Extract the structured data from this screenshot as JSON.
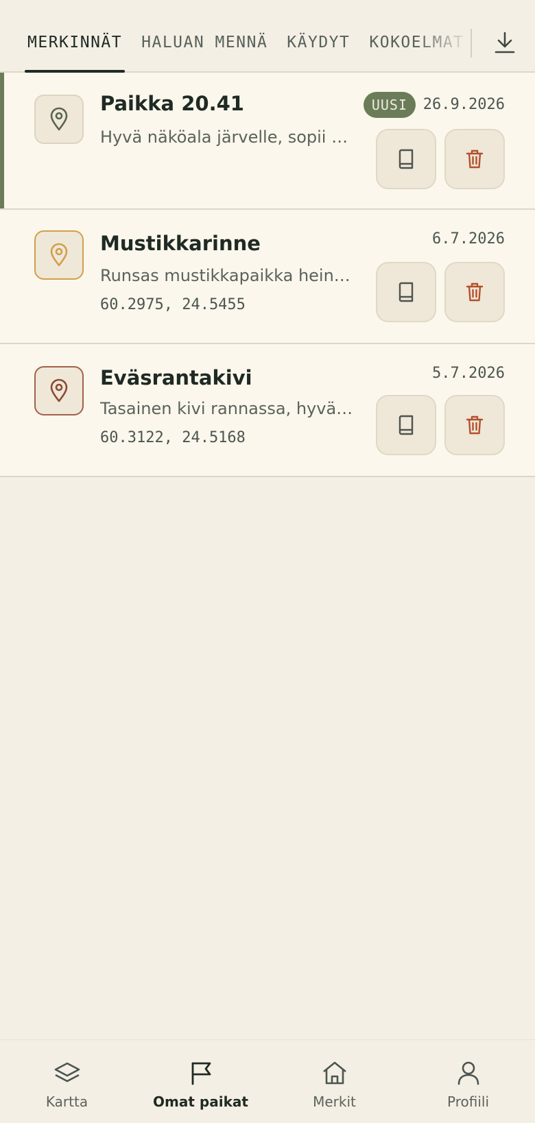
{
  "tabs": [
    {
      "label": "MERKINNÄT",
      "active": true
    },
    {
      "label": "HALUAN MENNÄ",
      "active": false
    },
    {
      "label": "KÄYDYT",
      "active": false
    },
    {
      "label": "KOKOELMAT",
      "active": false
    }
  ],
  "items": [
    {
      "title": "Paikka 20.41",
      "desc": "Hyvä näköala järvelle, sopii e...",
      "coords": "",
      "date": "26.9.2026",
      "badge": "UUSI",
      "pin_color": "#5a6451"
    },
    {
      "title": "Mustikkarinne",
      "desc": "Runsas mustikkapaikka heinä...",
      "coords": "60.2975, 24.5455",
      "date": "6.7.2026",
      "badge": "",
      "pin_color": "#d0a04a"
    },
    {
      "title": "Eväsrantakivi",
      "desc": "Tasainen kivi rannassa, hyvä p...",
      "coords": "60.3122, 24.5168",
      "date": "5.7.2026",
      "badge": "",
      "pin_color": "#8a4a34"
    }
  ],
  "nav": [
    {
      "label": "Kartta",
      "icon": "layers-icon"
    },
    {
      "label": "Omat paikat",
      "icon": "flag-icon",
      "active": true
    },
    {
      "label": "Merkit",
      "icon": "home-icon"
    },
    {
      "label": "Profiili",
      "icon": "user-icon"
    }
  ],
  "colors": {
    "accent": "#6b7c58",
    "trash": "#b3502c",
    "background": "#f4efe4",
    "card": "#fbf7ec"
  }
}
